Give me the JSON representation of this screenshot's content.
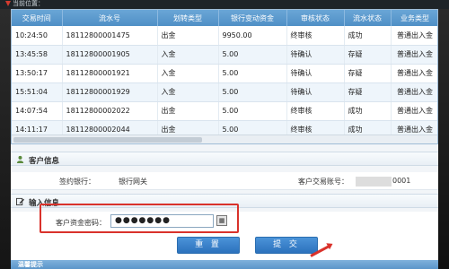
{
  "header": {
    "brand": "当前位置："
  },
  "table": {
    "columns": [
      "交易时间",
      "流水号",
      "划转类型",
      "银行变动资金",
      "审核状态",
      "流水状态",
      "业务类型"
    ],
    "rows": [
      [
        "10:24:50",
        "18112800001475",
        "出金",
        "9950.00",
        "终审核",
        "成功",
        "普通出入金"
      ],
      [
        "13:45:58",
        "18112800001905",
        "入金",
        "5.00",
        "待确认",
        "存疑",
        "普通出入金"
      ],
      [
        "13:50:17",
        "18112800001921",
        "入金",
        "5.00",
        "待确认",
        "存疑",
        "普通出入金"
      ],
      [
        "15:51:04",
        "18112800001929",
        "入金",
        "5.00",
        "待确认",
        "存疑",
        "普通出入金"
      ],
      [
        "14:07:54",
        "18112800002022",
        "出金",
        "5.00",
        "终审核",
        "成功",
        "普通出入金"
      ],
      [
        "14:11:17",
        "18112800002044",
        "出金",
        "5.00",
        "终审核",
        "成功",
        "普通出入金"
      ]
    ]
  },
  "customer_info": {
    "title": "客户信息",
    "bank_label": "签约银行：",
    "bank_value": "银行网关",
    "account_label": "客户交易账号：",
    "account_value_visible": "0001"
  },
  "input_info": {
    "title": "输入信息",
    "password_label": "客户资金密码：",
    "password_value": "●●●●●●●"
  },
  "buttons": {
    "reset": "重 置",
    "submit": "提 交"
  },
  "bottom_section": {
    "title": "温馨提示"
  },
  "colors": {
    "header_blue": "#4f8fc6",
    "button_blue": "#2c72bd",
    "highlight_red": "#d9322b"
  }
}
